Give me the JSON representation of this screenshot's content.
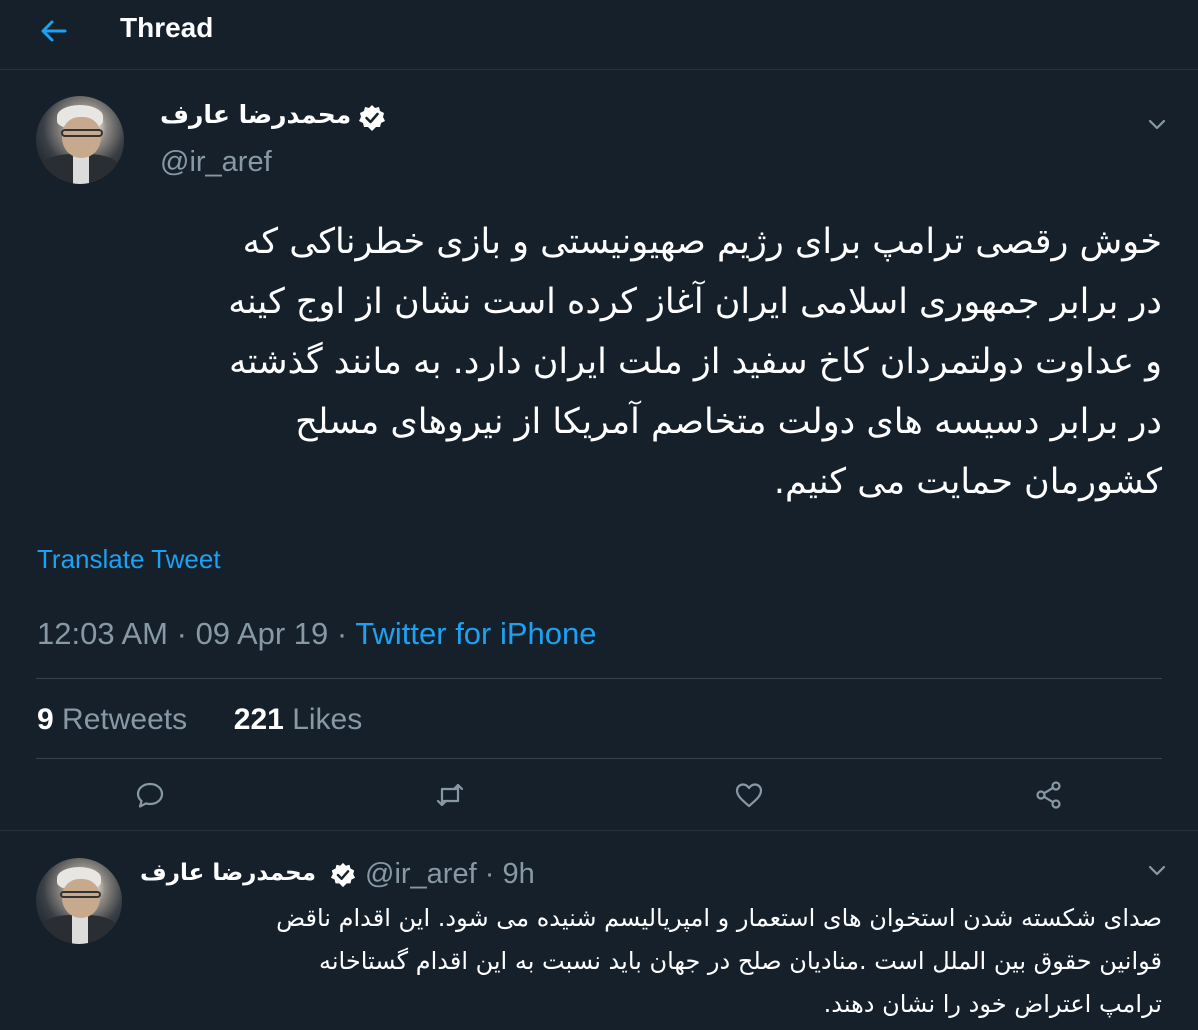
{
  "header": {
    "title": "Thread"
  },
  "main_tweet": {
    "author_name": "محمدرضا عارف",
    "handle": "@ir_aref",
    "text_lines": [
      "خوش رقصی ترامپ برای رژیم صهیونیستی و بازی خطرناکی که",
      "در برابر جمهوری اسلامی ایران آغاز کرده است نشان از اوج کینه",
      "و عداوت دولتمردان کاخ سفید از ملت ایران دارد. به مانند گذشته",
      "در برابر دسیسه های دولت متخاصم آمریکا از نیروهای مسلح",
      "کشورمان حمایت می کنیم."
    ],
    "translate_label": "Translate Tweet",
    "time": "12:03 AM",
    "date": "09 Apr 19",
    "separator": "·",
    "source": "Twitter for iPhone",
    "retweets_count": "9",
    "retweets_label": "Retweets",
    "likes_count": "221",
    "likes_label": "Likes"
  },
  "reply_tweet": {
    "author_name": "محمدرضا عارف",
    "handle": "@ir_aref",
    "separator": "·",
    "age": "9h",
    "text_lines": [
      "صدای شکسته شدن استخوان های استعمار و امپریالیسم  شنیده می شود. این اقدام ناقض",
      "قوانین حقوق بین الملل است .منادیان صلح در جهان باید نسبت به این اقدام گستاخانه",
      "ترامپ اعتراض خود را نشان دهند."
    ]
  },
  "colors": {
    "background": "#15202b",
    "accent": "#1da1f2",
    "secondary_text": "#8899a6",
    "divider": "#38444d"
  },
  "icons": {
    "back": "arrow-left-icon",
    "verified": "verified-badge-icon",
    "chevron": "chevron-down-icon",
    "reply": "reply-icon",
    "retweet": "retweet-icon",
    "like": "heart-icon",
    "share": "share-icon"
  }
}
